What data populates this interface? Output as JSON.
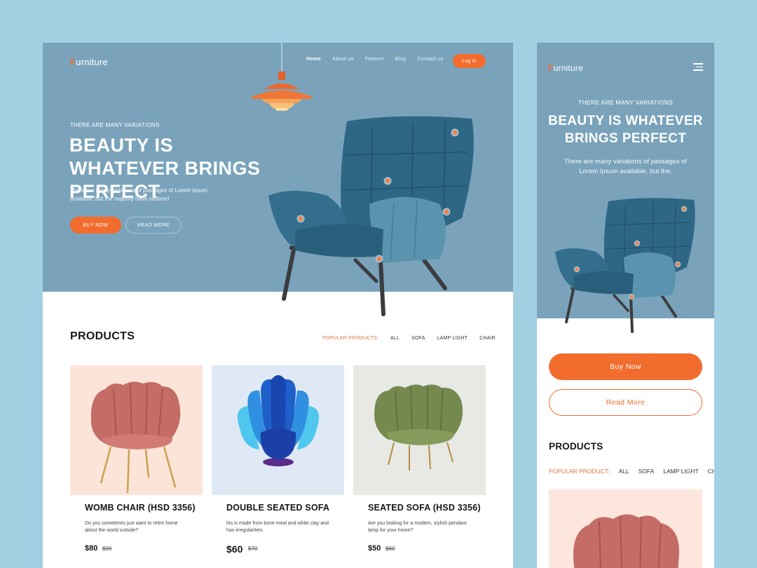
{
  "desktop": {
    "logo": {
      "initial": "F",
      "rest": "urniture"
    },
    "nav": [
      {
        "label": "Home",
        "active": true
      },
      {
        "label": "About us",
        "active": false
      },
      {
        "label": "Feature",
        "active": false
      },
      {
        "label": "Blog",
        "active": false
      },
      {
        "label": "Contact us",
        "active": false
      }
    ],
    "login_label": "Log in",
    "hero": {
      "eyebrow": "THERE ARE MANY VARIATIONS",
      "title": "BEAUTY IS WHATEVER BRINGS PERFECT",
      "subtitle": "There are many variations of passages of Lorem Ipsum available, but the majority have suffered",
      "buy_label": "BUY NOW",
      "read_label": "READ MORE"
    },
    "products": {
      "title": "PRODUCTS",
      "filters": [
        "POPULAR PRODUCTS:",
        "ALL",
        "SOFA",
        "LAMP LIGHT",
        "CHAIR"
      ],
      "cards": [
        {
          "name": "WOMB CHAIR (HSD 3356)",
          "desc": "Do you sometimes just want to retire home about the world outside?",
          "price": "$80",
          "old_price": "$99",
          "bg": "#fde4d8"
        },
        {
          "name": "DOUBLE SEATED SOFA",
          "desc": "his is made from bone meal and white clay and has irregularities.",
          "price": "$60",
          "old_price": "$70",
          "bg": "#dfe9f6"
        },
        {
          "name": "SEATED SOFA (HSD 3356)",
          "desc": "Are you looking for a modern, stylish pendant lamp for your home?",
          "price": "$50",
          "old_price": "$60",
          "bg": "#e8e9e5"
        }
      ]
    }
  },
  "mobile": {
    "logo": {
      "initial": "F",
      "rest": "urniture"
    },
    "hero": {
      "eyebrow": "THERE ARE MANY VARIATIONS",
      "title": "BEAUTY IS WHATEVER BRINGS PERFECT",
      "subtitle": "There are many variations of passages of Lorem Ipsum available, but the."
    },
    "buy_label": "Buy Now",
    "read_label": "Read More",
    "products_title": "PRODUCTS",
    "filters": [
      "POPULAR PRODUCT:",
      "ALL",
      "SOFA",
      "LAMP LIGHT",
      "CHAIR"
    ]
  },
  "colors": {
    "accent": "#f26d2d",
    "hero_bg": "#7aa3bb",
    "page_bg": "#a3cfe3",
    "chair_teal": "#2f6a86"
  },
  "icons": [
    "pendant-lamp-icon",
    "menu-icon"
  ]
}
